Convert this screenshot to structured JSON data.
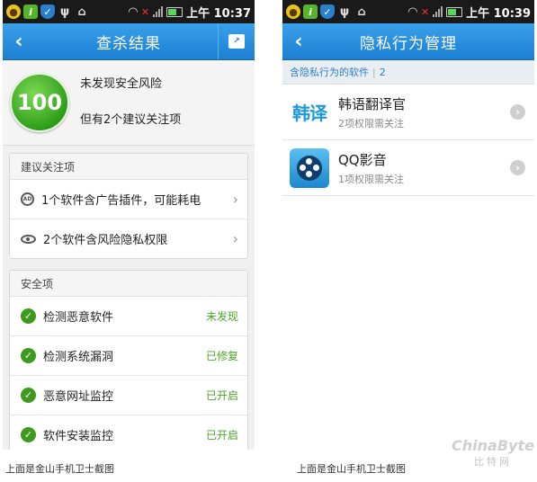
{
  "status_bar": {
    "time_left": "上午 10:37",
    "time_right": "上午 10:39"
  },
  "left": {
    "title": "查杀结果",
    "score": "100",
    "summary_line1": "未发现安全风险",
    "summary_line2": "但有2个建议关注项",
    "suggest_section": {
      "header": "建议关注项",
      "items": [
        {
          "label": "1个软件含广告插件，可能耗电",
          "icon": "ad-icon"
        },
        {
          "label": "2个软件含风险隐私权限",
          "icon": "eye-icon"
        }
      ]
    },
    "safety_section": {
      "header": "安全项",
      "items": [
        {
          "label": "检测恶意软件",
          "status": "未发现"
        },
        {
          "label": "检测系统漏洞",
          "status": "已修复"
        },
        {
          "label": "恶意网址监控",
          "status": "已开启"
        },
        {
          "label": "软件安装监控",
          "status": "已开启"
        }
      ]
    }
  },
  "right": {
    "title": "隐私行为管理",
    "subheader_label": "含隐私行为的软件",
    "subheader_count": "2",
    "apps": [
      {
        "name": "韩语翻译官",
        "sub": "2项权限需关注",
        "icon_text": "韩译"
      },
      {
        "name": "QQ影音",
        "sub": "1项权限需关注"
      }
    ]
  },
  "captions": {
    "left": "上面是金山手机卫士截图",
    "right": "上面是金山手机卫士截图"
  },
  "watermark": {
    "brand": "ChinaByte",
    "sub": "比特网"
  },
  "colors": {
    "titlebar": "#1c7fd3",
    "ok_green": "#4da32a",
    "score_green": "#2f9e19"
  }
}
